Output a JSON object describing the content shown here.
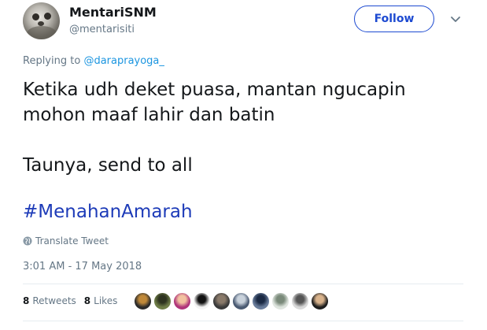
{
  "user": {
    "name": "MentariSNM",
    "handle": "@mentarisiti",
    "follow_label": "Follow"
  },
  "reply": {
    "prefix": "Replying to",
    "to": "@daraprayoga_"
  },
  "tweet": {
    "text": "Ketika udh deket puasa, mantan ngucapin\nmohon maaf lahir dan batin\n\nTaunya, send to all",
    "hashtag": "#MenahanAmarah",
    "translate_label": "Translate Tweet",
    "timestamp": "3:01 AM - 17 May 2018"
  },
  "stats": {
    "retweets_count": "8",
    "retweets_label": "Retweets",
    "likes_count": "8",
    "likes_label": "Likes"
  },
  "likers": [
    {
      "name": "liker-avatar",
      "color": "#2b2b2b",
      "accent": "#c0893a"
    },
    {
      "name": "liker-avatar",
      "color": "#6f7d48",
      "accent": "#2e3320"
    },
    {
      "name": "liker-avatar",
      "color": "#b0357a",
      "accent": "#f2c2a0"
    },
    {
      "name": "liker-avatar",
      "color": "#f5f5f5",
      "accent": "#111111"
    },
    {
      "name": "liker-avatar",
      "color": "#3a3a3a",
      "accent": "#8a7a6a"
    },
    {
      "name": "liker-avatar",
      "color": "#4a5a72",
      "accent": "#c9d2dc"
    },
    {
      "name": "liker-avatar",
      "color": "#6a7d9b",
      "accent": "#1b2a44"
    },
    {
      "name": "liker-avatar",
      "color": "#dfe5df",
      "accent": "#7a8a7a"
    },
    {
      "name": "liker-avatar",
      "color": "#d9d9d9",
      "accent": "#555555"
    },
    {
      "name": "liker-avatar",
      "color": "#1e1e1e",
      "accent": "#d9b38c"
    }
  ],
  "colors": {
    "link": "#1b95e0",
    "hashtag": "#1d3bb8",
    "follow_border": "#1d4ad1",
    "muted": "#657786"
  },
  "icons": {
    "translate": "globe-icon",
    "menu": "chevron-down-icon"
  }
}
